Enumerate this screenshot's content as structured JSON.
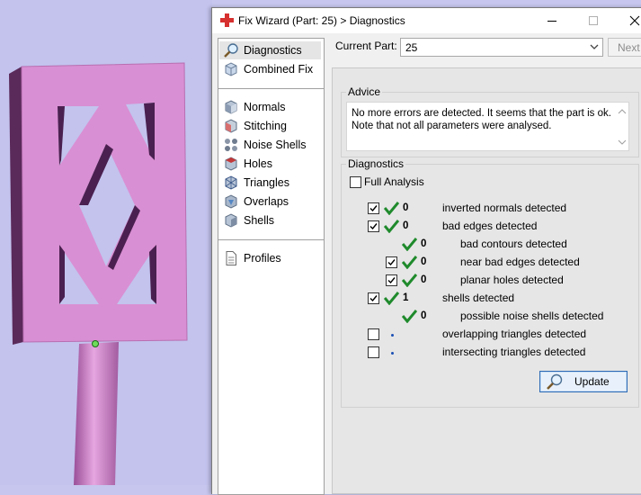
{
  "window": {
    "title": "Fix Wizard (Part: 25) > Diagnostics"
  },
  "nav": {
    "items": [
      {
        "label": "Diagnostics",
        "icon": "magnifier-icon",
        "selected": true
      },
      {
        "label": "Combined Fix",
        "icon": "cube-fix-icon"
      }
    ],
    "tools": [
      {
        "label": "Normals",
        "icon": "normals-cube-icon"
      },
      {
        "label": "Stitching",
        "icon": "stitching-cube-icon"
      },
      {
        "label": "Noise Shells",
        "icon": "noise-shells-icon"
      },
      {
        "label": "Holes",
        "icon": "holes-cube-icon"
      },
      {
        "label": "Triangles",
        "icon": "triangles-cube-icon"
      },
      {
        "label": "Overlaps",
        "icon": "overlaps-cube-icon"
      },
      {
        "label": "Shells",
        "icon": "shells-cube-icon"
      }
    ],
    "profiles": {
      "label": "Profiles",
      "icon": "document-icon"
    }
  },
  "current_part": {
    "label": "Current Part:",
    "value": "25",
    "next_label": "Next"
  },
  "advice": {
    "title": "Advice",
    "text": "No more errors are detected. It seems that the part is ok.\nNote that not all parameters were analysed."
  },
  "diagnostics": {
    "title": "Diagnostics",
    "full_analysis_label": "Full Analysis",
    "full_analysis_checked": false,
    "rows": [
      {
        "checkbox": true,
        "checked": true,
        "status": "ok",
        "count": "0",
        "label": "inverted normals detected",
        "indent": 0
      },
      {
        "checkbox": true,
        "checked": true,
        "status": "ok",
        "count": "0",
        "label": "bad edges detected",
        "indent": 0
      },
      {
        "checkbox": false,
        "checked": false,
        "status": "ok",
        "count": "0",
        "label": "bad contours detected",
        "indent": 1
      },
      {
        "checkbox": true,
        "checked": true,
        "status": "ok",
        "count": "0",
        "label": "near bad edges detected",
        "indent": 1
      },
      {
        "checkbox": true,
        "checked": true,
        "status": "ok",
        "count": "0",
        "label": "planar holes detected",
        "indent": 1
      },
      {
        "checkbox": true,
        "checked": true,
        "status": "ok",
        "count": "1",
        "label": "shells detected",
        "indent": 0
      },
      {
        "checkbox": false,
        "checked": false,
        "status": "ok",
        "count": "0",
        "label": "possible noise shells detected",
        "indent": 1
      },
      {
        "checkbox": true,
        "checked": false,
        "status": "pending",
        "count": "",
        "label": "overlapping triangles detected",
        "indent": 0
      },
      {
        "checkbox": true,
        "checked": false,
        "status": "pending",
        "count": "",
        "label": "intersecting triangles detected",
        "indent": 0
      }
    ],
    "update_label": "Update"
  },
  "colors": {
    "accent": "#2d6ab4",
    "check_green": "#1f8a2c",
    "model_pink": "#dc8ad6",
    "viewport_bg": "#c3c3ee"
  }
}
